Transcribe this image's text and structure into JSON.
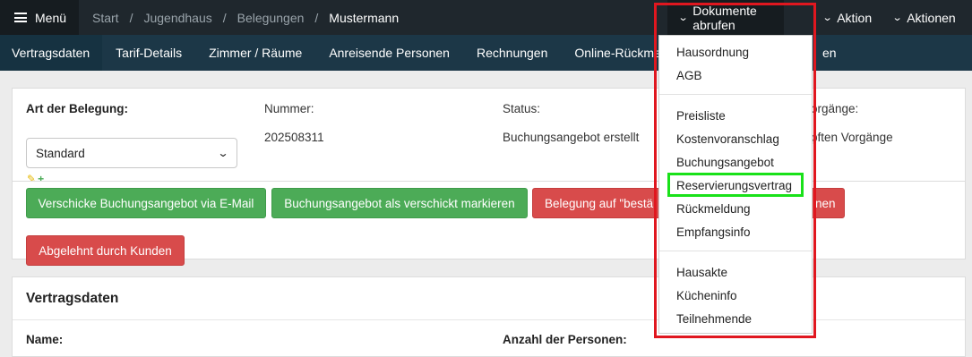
{
  "topbar": {
    "menu_label": "Menü",
    "breadcrumb": [
      "Start",
      "Jugendhaus",
      "Belegungen",
      "Mustermann"
    ],
    "documents_button": "Dokumente abrufen",
    "action_button": "Aktion",
    "actions_button": "Aktionen"
  },
  "tabs": [
    "Vertragsdaten",
    "Tarif-Details",
    "Zimmer / Räume",
    "Anreisende Personen",
    "Rechnungen",
    "Online-Rückmeldu",
    "en"
  ],
  "booking": {
    "type_label": "Art der Belegung:",
    "type_value": "Standard",
    "number_label": "Nummer:",
    "number_value": "202508311",
    "status_label": "Status:",
    "status_value": "Buchungsangebot erstellt",
    "linked_label": "orgänge:",
    "linked_value": "pften Vorgänge"
  },
  "buttons": {
    "send_offer": "Verschicke Buchungsangebot via E-Mail",
    "mark_sent": "Buchungsangebot als verschickt markieren",
    "confirm": "Belegung auf \"bestä",
    "confirm_tail": "nen",
    "rejected": "Abgelehnt durch Kunden"
  },
  "contract": {
    "title": "Vertragsdaten",
    "name_label": "Name:",
    "persons_label": "Anzahl der Personen:"
  },
  "documents_menu": {
    "group1": [
      "Hausordnung",
      "AGB"
    ],
    "group2": [
      "Preisliste",
      "Kostenvoranschlag",
      "Buchungsangebot",
      "Reservierungsvertrag",
      "Rückmeldung",
      "Empfangsinfo"
    ],
    "group3": [
      "Hausakte",
      "Kücheninfo",
      "Teilnehmende"
    ]
  },
  "colors": {
    "topbar": "#1f272d",
    "tabbar": "#1c3747",
    "green_button": "#4cab57",
    "red_button": "#d84b4b",
    "highlight_red": "#e0171f",
    "highlight_green": "#19e119"
  }
}
